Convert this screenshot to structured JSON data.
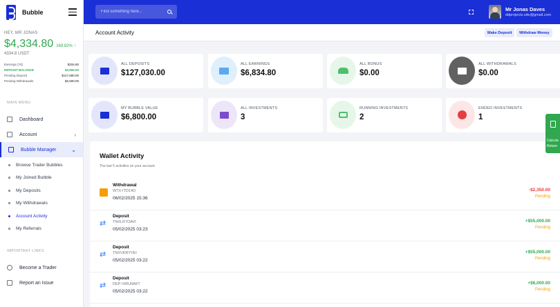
{
  "brand": {
    "name": "Bubble"
  },
  "sidebar": {
    "greeting": "HEY, MR JONAS",
    "balance": "$4,334.80",
    "balance_change": "169.82% ↑",
    "balance_usdt": "4334.8 USDT",
    "stats": [
      {
        "label": "Earnings (7d)",
        "value": "$334.80"
      },
      {
        "label": "DEPOSIT BALANCE",
        "value": "$2,550.00"
      },
      {
        "label": "Pending Deposit",
        "value": "$117,680.00"
      },
      {
        "label": "Pending Withdrawals",
        "value": "$2,500.00"
      }
    ],
    "main_menu_label": "MAIN MENU",
    "dashboard": "Dashboard",
    "account": "Account",
    "bubble_manager": "Bubble Manager",
    "sub_items": [
      "Browse Trader Bubbles",
      "My Joined Bubble",
      "My Deposits",
      "My Withdrawals",
      "Account Activity",
      "My Referrals"
    ],
    "important_links_label": "IMPORTANT LINKS",
    "become_trader": "Become a Trader",
    "report_issue": "Report an Issue"
  },
  "topbar": {
    "search_placeholder": "Find something here...",
    "user_name": "Mr Jonas Daves",
    "user_email": "ddprojects.site@gmail.com"
  },
  "header": {
    "title": "Account Activity",
    "make_deposit": "Make Deposit",
    "withdraw_money": "Withdraw Money"
  },
  "cards": [
    {
      "label": "ALL DEPOSITS",
      "value": "$127,030.00"
    },
    {
      "label": "ALL EARNINGS",
      "value": "$6,834.80"
    },
    {
      "label": "ALL BONUS",
      "value": "$0.00"
    },
    {
      "label": "ALL WITHDRAWALS",
      "value": "$0.00"
    },
    {
      "label": "MY BUBBLE VALUE",
      "value": "$6,800.00"
    },
    {
      "label": "ALL INVESTMENTS",
      "value": "3"
    },
    {
      "label": "RUNNING INVESTMENTS",
      "value": "2"
    },
    {
      "label": "ENDED INVESTMENTS",
      "value": "1"
    }
  ],
  "wallet": {
    "title": "Wallet Activity",
    "subtitle": "The last 5 activities on your account.",
    "rows": [
      {
        "type": "Withdrawal",
        "id": "WTX-ITD14O",
        "date": "06/02/2025 15:36",
        "amount": "-$2,350.00",
        "status": "Pending"
      },
      {
        "type": "Deposit",
        "id": "TNXLR7OAVI",
        "date": "05/02/2025 03:23",
        "amount": "+$55,000.00",
        "status": "Pending"
      },
      {
        "type": "Deposit",
        "id": "TNXVKRYVEI",
        "date": "05/02/2025 03:22",
        "amount": "+$55,000.00",
        "status": "Pending"
      },
      {
        "type": "Deposit",
        "id": "DEP-VWU0AKT",
        "date": "05/02/2025 03:22",
        "amount": "+$6,000.00",
        "status": "Pending"
      }
    ]
  },
  "float_button": {
    "line1": "Calcula",
    "line2": "Return"
  },
  "colors": {
    "brand": "#1a2fd6",
    "positive": "#2fa84f",
    "negative": "#e53e3e",
    "pending": "#f59e0b"
  }
}
